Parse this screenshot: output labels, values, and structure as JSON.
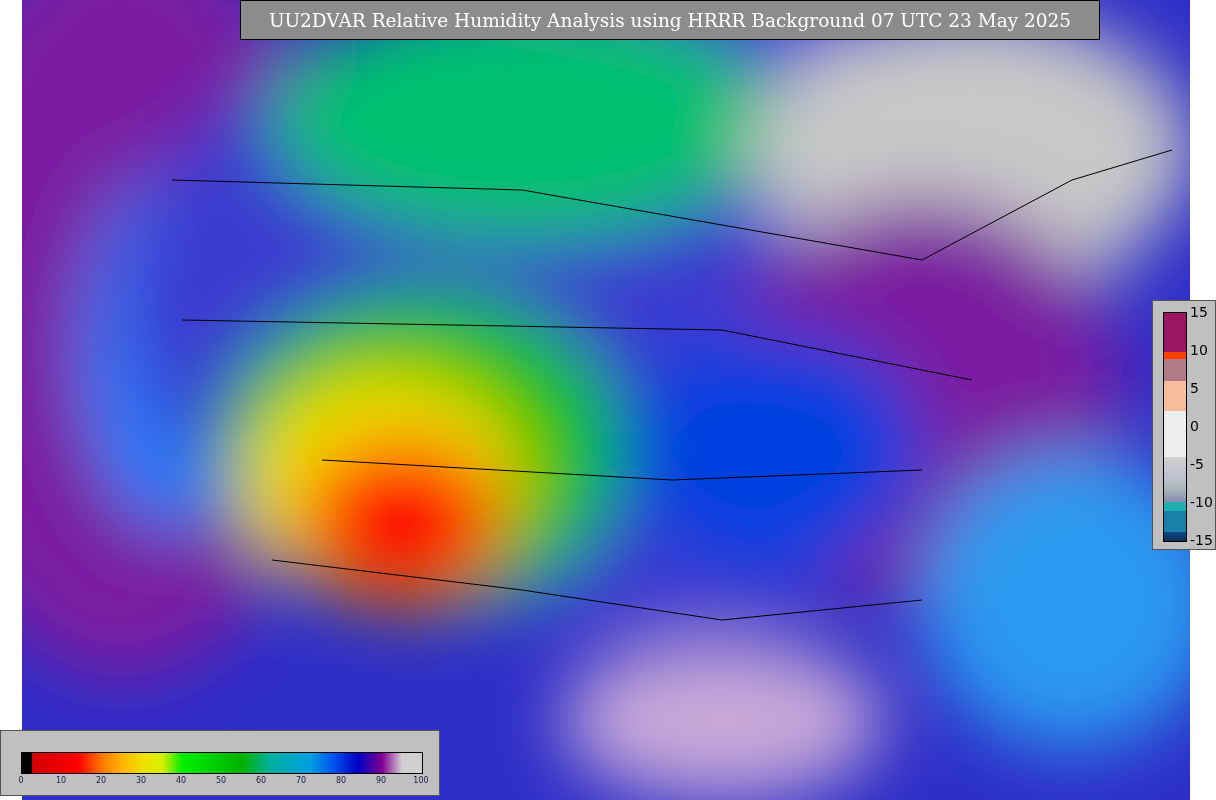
{
  "title": "UU2DVAR Relative Humidity Analysis using HRRR Background 07 UTC 23 May 2025",
  "humidity_colorbar": {
    "tick_labels": [
      "0",
      "10",
      "20",
      "30",
      "40",
      "50",
      "60",
      "70",
      "80",
      "90",
      "100"
    ]
  },
  "difference_colorbar": {
    "tick_labels": [
      "15",
      "10",
      "5",
      "0",
      "-5",
      "-10",
      "-15"
    ]
  }
}
